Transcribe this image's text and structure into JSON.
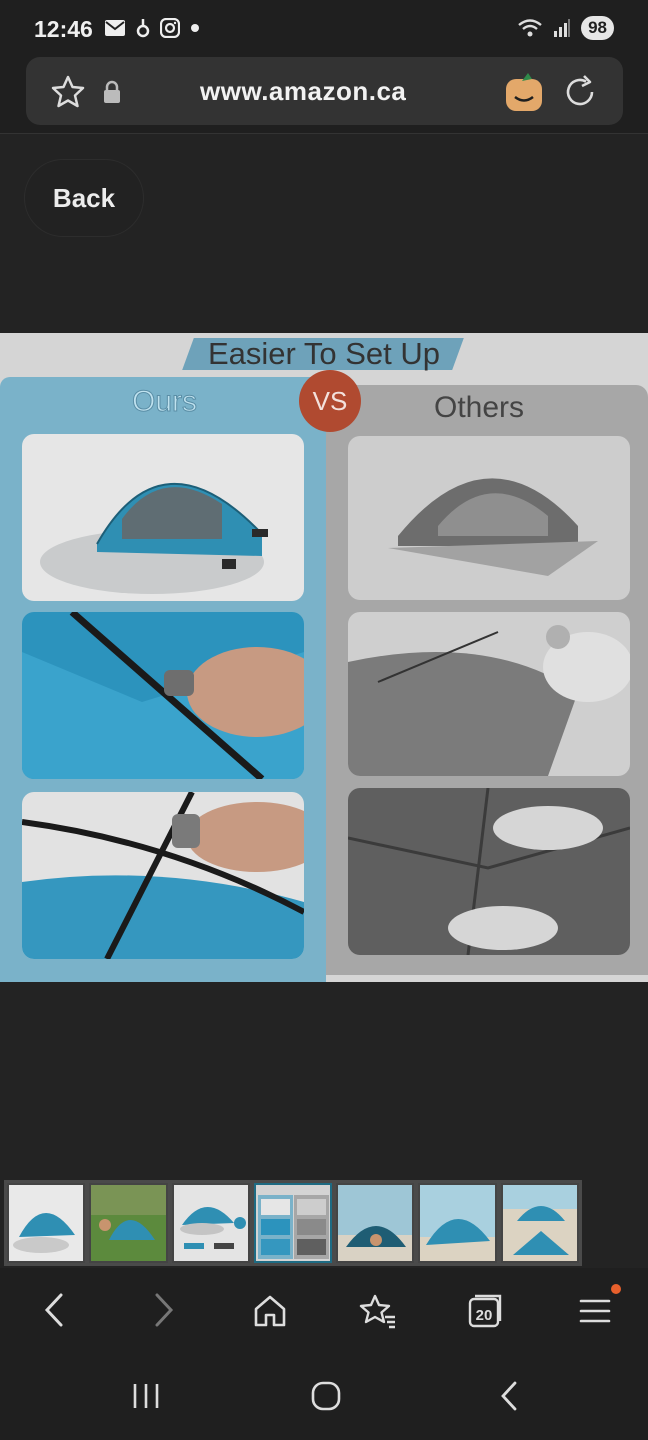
{
  "status_bar": {
    "time": "12:46",
    "battery": "98",
    "icons": [
      "mail-icon",
      "notification-icon",
      "instagram-icon",
      "dot-icon",
      "wifi-icon",
      "signal-icon"
    ]
  },
  "browser": {
    "url": "www.amazon.ca",
    "icons": [
      "star-icon",
      "lock-icon",
      "amazon-extension-icon",
      "reload-icon"
    ]
  },
  "back_button": {
    "label": "Back"
  },
  "product_image": {
    "title": "Easier To Set Up",
    "left_label": "Ours",
    "right_label": "Others",
    "vs_label": "VS"
  },
  "thumbnails": {
    "count": 7,
    "selected_index": 3
  },
  "nav": {
    "tabs_count": "20",
    "icons": [
      "back-arrow-icon",
      "forward-arrow-icon",
      "home-icon",
      "bookmarks-icon",
      "tabs-icon",
      "menu-icon"
    ]
  },
  "system_nav": {
    "icons": [
      "recents-icon",
      "home-circle-icon",
      "system-back-icon"
    ]
  },
  "colors": {
    "accent": "#1e6b83",
    "ours_panel": "#7ab2c9",
    "vs_badge": "#b04a30",
    "notification_dot": "#e8602c"
  }
}
